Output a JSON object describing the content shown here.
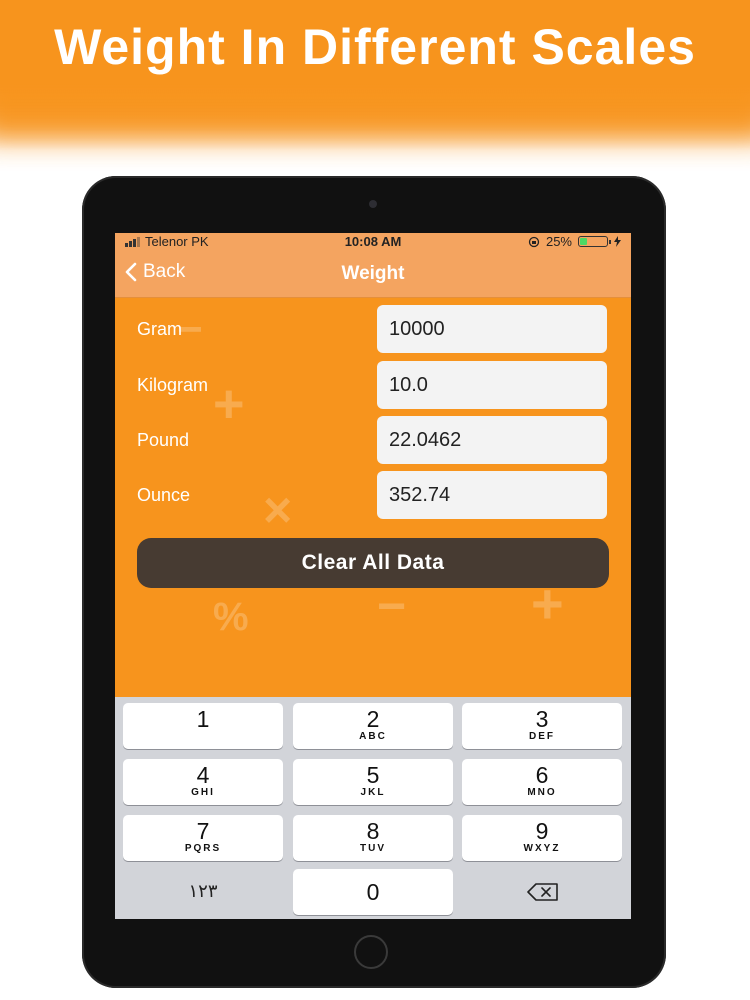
{
  "headline": "Weight In Different Scales",
  "status": {
    "carrier": "Telenor PK",
    "time": "10:08 AM",
    "battery": "25%",
    "battery_level": 0.25
  },
  "nav": {
    "back_label": "Back",
    "title": "Weight"
  },
  "fields": [
    {
      "label": "Gram",
      "value": "10000"
    },
    {
      "label": "Kilogram",
      "value": "10.0"
    },
    {
      "label": "Pound",
      "value": "22.0462"
    },
    {
      "label": "Ounce",
      "value": "352.74"
    }
  ],
  "clear_button_label": "Clear All Data",
  "keypad": [
    {
      "num": "1",
      "letters": ""
    },
    {
      "num": "2",
      "letters": "ABC"
    },
    {
      "num": "3",
      "letters": "DEF"
    },
    {
      "num": "4",
      "letters": "GHI"
    },
    {
      "num": "5",
      "letters": "JKL"
    },
    {
      "num": "6",
      "letters": "MNO"
    },
    {
      "num": "7",
      "letters": "PQRS"
    },
    {
      "num": "8",
      "letters": "TUV"
    },
    {
      "num": "9",
      "letters": "WXYZ"
    }
  ],
  "keypad_bottom": {
    "numerals_switch": "١٢٣",
    "zero": "0"
  },
  "icons": {
    "back": "chevron-left-icon",
    "backspace": "backspace-icon",
    "rotation_lock": "rotation-lock-icon",
    "charging": "bolt-icon"
  },
  "colors": {
    "accent": "#f7941d",
    "navbar": "#f4a460",
    "button_dark": "#473b32"
  }
}
